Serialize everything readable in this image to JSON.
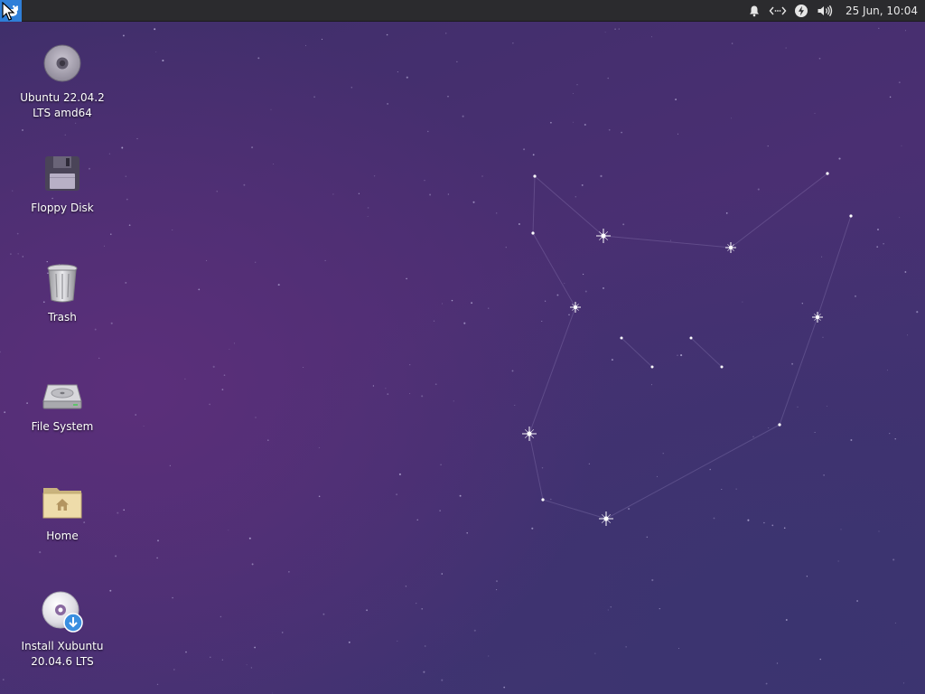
{
  "panel": {
    "clock": "25 Jun, 10:04",
    "tray_icons": [
      "bell-icon",
      "network-icon",
      "power-icon",
      "volume-icon"
    ]
  },
  "desktop": {
    "icons": [
      {
        "id": "ubuntu-disc",
        "label": "Ubuntu 22.04.2\nLTS amd64",
        "icon": "optical-disc-icon"
      },
      {
        "id": "floppy",
        "label": "Floppy Disk",
        "icon": "floppy-disk-icon"
      },
      {
        "id": "trash",
        "label": "Trash",
        "icon": "trash-icon"
      },
      {
        "id": "filesystem",
        "label": "File System",
        "icon": "hard-drive-icon"
      },
      {
        "id": "home",
        "label": "Home",
        "icon": "home-folder-icon"
      },
      {
        "id": "install",
        "label": "Install Xubuntu\n20.04.6 LTS",
        "icon": "install-disc-icon"
      }
    ]
  },
  "colors": {
    "panel_bg": "#2b2b2e",
    "whisker_bg": "#2f7fd8",
    "desktop_base": "#45306e",
    "desktop_glow": "#5b2f7a"
  }
}
